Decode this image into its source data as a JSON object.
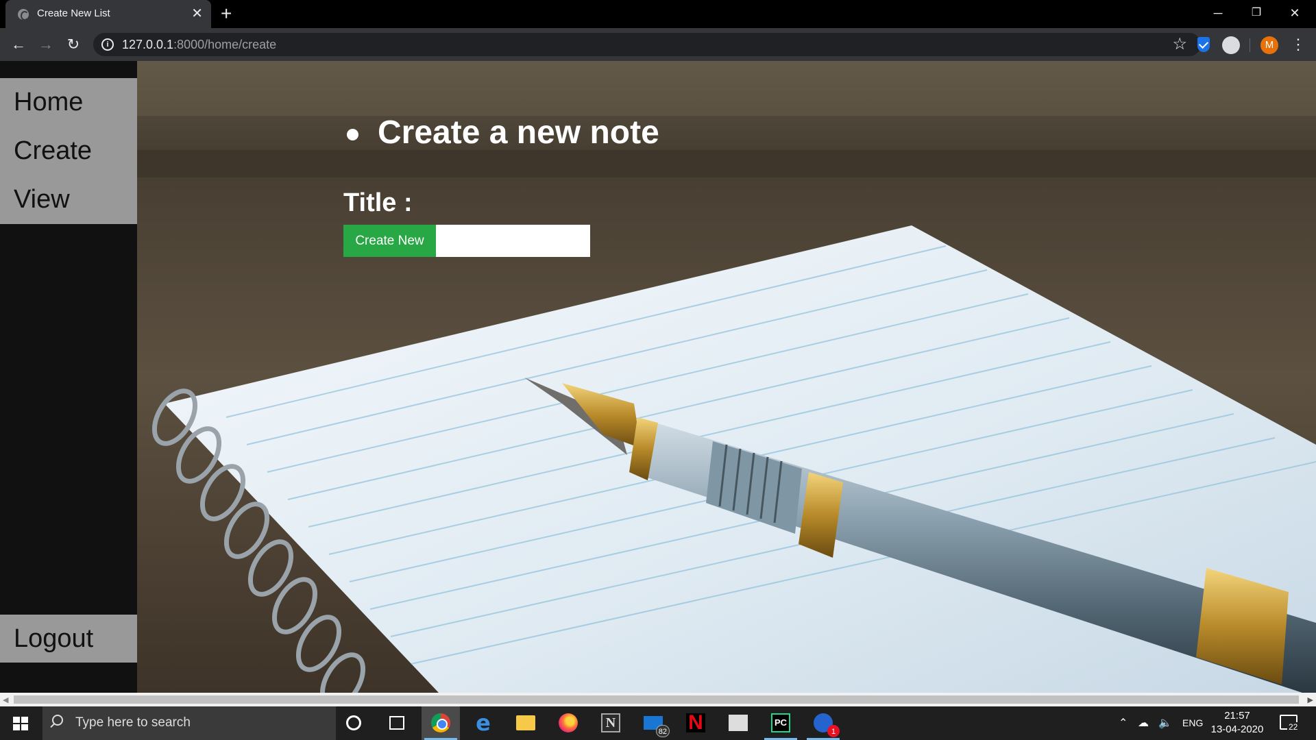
{
  "browser": {
    "tab_title": "Create New List",
    "tab_close": "✕",
    "new_tab": "+",
    "url_host": "127.0.0.1",
    "url_rest": ":8000/home/create",
    "profile_initial": "M",
    "window_controls": {
      "minimize": "─",
      "restore": "❐",
      "close": "✕"
    }
  },
  "sidebar": {
    "items": [
      {
        "label": "Home"
      },
      {
        "label": "Create"
      },
      {
        "label": "View"
      }
    ],
    "logout_label": "Logout"
  },
  "main": {
    "heading": "Create a new note",
    "title_label": "Title :",
    "create_button_label": "Create New",
    "title_input_value": ""
  },
  "taskbar": {
    "search_placeholder": "Type here to search",
    "mail_badge": "82",
    "todo_badge": "1",
    "language": "ENG",
    "time": "21:57",
    "date": "13-04-2020",
    "notification_count": "22",
    "apps": [
      "chrome",
      "edge",
      "file-explorer",
      "firefox",
      "notion",
      "mail",
      "netflix",
      "store",
      "pycharm",
      "todo"
    ]
  },
  "colors": {
    "create_button": "#28a745",
    "sidebar_block": "#999999",
    "sidebar_bg": "#111111",
    "profile_avatar": "#e8710a",
    "taskbar_active": "#76b9ed"
  }
}
